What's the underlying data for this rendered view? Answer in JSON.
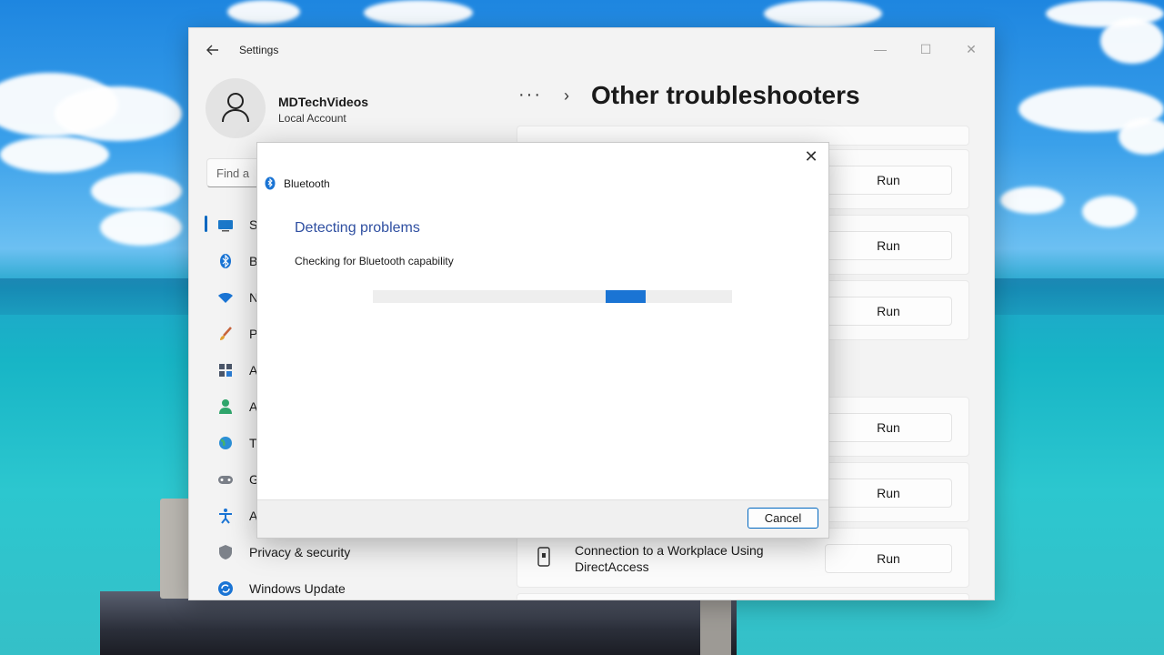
{
  "window": {
    "app_title": "Settings",
    "controls": {
      "minimize": "—",
      "maximize": "☐",
      "close": "✕"
    }
  },
  "profile": {
    "name": "MDTechVideos",
    "account_type": "Local Account"
  },
  "search": {
    "value": "Find a"
  },
  "nav": {
    "items": [
      {
        "label": "S",
        "icon": "monitor-icon"
      },
      {
        "label": "B",
        "icon": "bluetooth-icon"
      },
      {
        "label": "N",
        "icon": "wifi-icon"
      },
      {
        "label": "P",
        "icon": "brush-icon"
      },
      {
        "label": "A",
        "icon": "apps-icon"
      },
      {
        "label": "A",
        "icon": "person-icon"
      },
      {
        "label": "T",
        "icon": "globe-icon"
      },
      {
        "label": "G",
        "icon": "gamepad-icon"
      },
      {
        "label": "A",
        "icon": "accessibility-icon"
      },
      {
        "label": "Privacy & security",
        "icon": "shield-icon"
      },
      {
        "label": "Windows Update",
        "icon": "update-icon"
      }
    ]
  },
  "breadcrumb": {
    "dots": "···",
    "chevron": "›"
  },
  "page": {
    "title": "Other troubleshooters"
  },
  "troubleshooters": {
    "run_label": "Run",
    "workplace_item": "Connection to a Workplace Using DirectAccess"
  },
  "dialog": {
    "close": "✕",
    "app_label": "Bluetooth",
    "heading": "Detecting problems",
    "status": "Checking for Bluetooth capability",
    "progress_indeterminate": true,
    "cancel_label": "Cancel"
  },
  "colors": {
    "accent": "#0067c0",
    "heading_blue": "#2f4fa1",
    "progress_fill": "#1a74d4"
  }
}
